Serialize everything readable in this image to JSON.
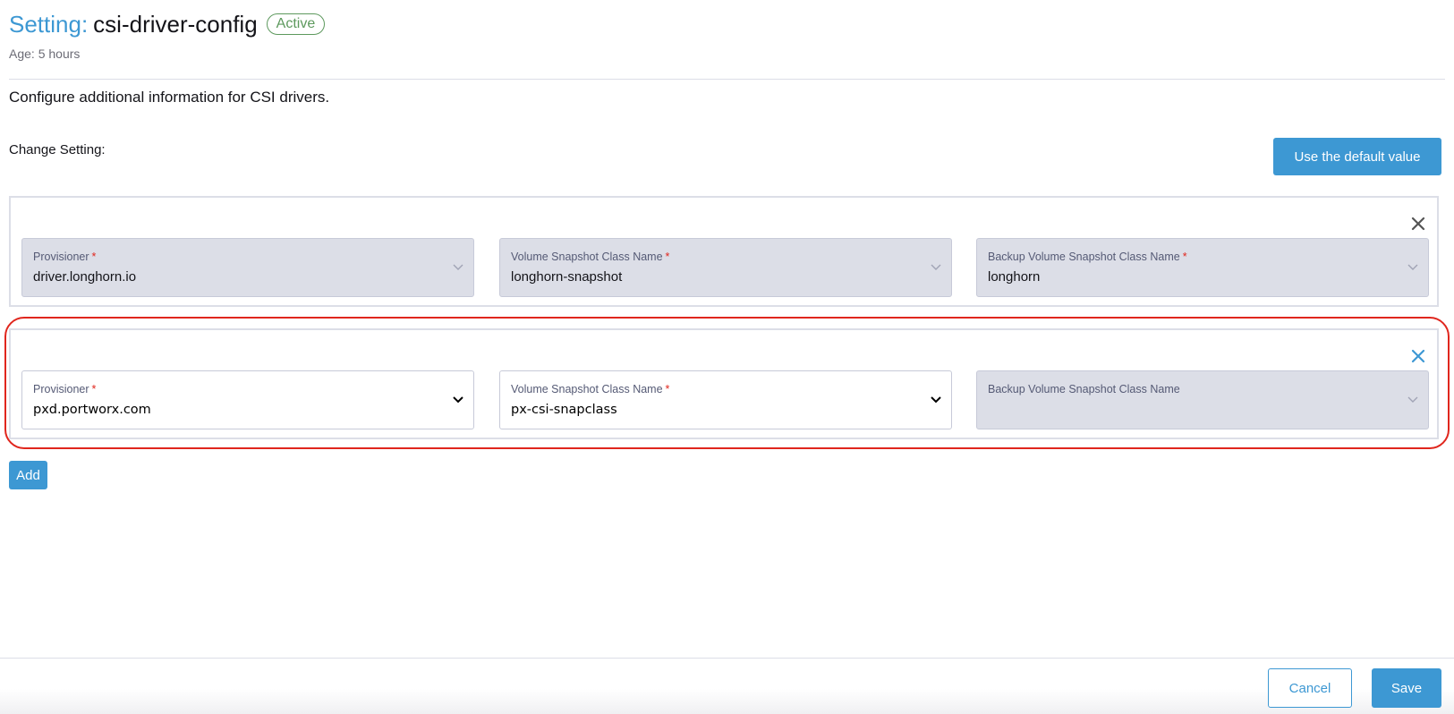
{
  "header": {
    "title_prefix": "Setting:",
    "title_name": "csi-driver-config",
    "status": "Active",
    "age": "Age: 5 hours"
  },
  "description": "Configure additional information for CSI drivers.",
  "change_setting_label": "Change Setting:",
  "default_button_label": "Use the default value",
  "rows": [
    {
      "provisioner": {
        "label": "Provisioner",
        "required": "*",
        "value": "driver.longhorn.io",
        "enabled": false
      },
      "snapshot_class": {
        "label": "Volume Snapshot Class Name",
        "required": "*",
        "value": "longhorn-snapshot",
        "enabled": false
      },
      "backup_snapshot_class": {
        "label": "Backup Volume Snapshot Class Name",
        "required": "*",
        "value": "longhorn",
        "enabled": false
      },
      "remove_icon": "close-icon",
      "remove_icon_color": "#555555"
    },
    {
      "provisioner": {
        "label": "Provisioner",
        "required": "*",
        "value": "pxd.portworx.com",
        "enabled": true
      },
      "snapshot_class": {
        "label": "Volume Snapshot Class Name",
        "required": "*",
        "value": "px-csi-snapclass",
        "enabled": true
      },
      "backup_snapshot_class": {
        "label": "Backup Volume Snapshot Class Name",
        "value": "",
        "enabled": false
      },
      "remove_icon": "close-icon",
      "remove_icon_color": "#3d98d3",
      "highlighted": true
    }
  ],
  "add_button_label": "Add",
  "footer": {
    "cancel_label": "Cancel",
    "save_label": "Save"
  },
  "colors": {
    "accent": "#3d98d3",
    "status_active": "#5d995d",
    "required": "#e0261d",
    "highlight": "#e0261d",
    "disabled_field_bg": "#dcdee7"
  }
}
